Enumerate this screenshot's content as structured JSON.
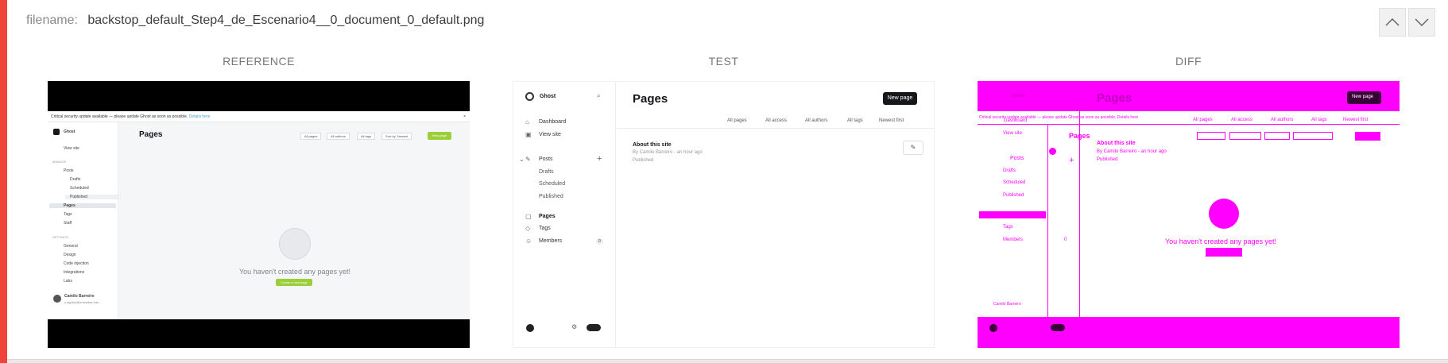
{
  "header": {
    "filename_label": "filename:",
    "filename_value": "backstop_default_Step4_de_Escenario4__0_document_0_default.png",
    "prev_icon": "chevron-up-icon",
    "next_icon": "chevron-down-icon"
  },
  "columns": {
    "reference": "REFERENCE",
    "test": "TEST",
    "diff": "DIFF"
  },
  "reference": {
    "notice": "Critical security update available — please update Ghost as soon as possible.",
    "notice_link": "Details here",
    "brand": "Ghost",
    "view_site": "View site",
    "manage_label": "MANAGE",
    "posts": "Posts",
    "drafts": "Drafts",
    "scheduled": "Scheduled",
    "published": "Published",
    "pages": "Pages",
    "tags": "Tags",
    "staff": "Staff",
    "settings_label": "SETTINGS",
    "general": "General",
    "design": "Design",
    "code_injection": "Code injection",
    "integrations": "Integrations",
    "labs": "Labs",
    "user_name": "Camilo Barreiro",
    "user_email": "c.aguilar@uniandes.edu...",
    "page_title": "Pages",
    "filter_pages": "All pages",
    "filter_authors": "All authors",
    "filter_tags": "All tags",
    "filter_sort": "Sort by: Newest",
    "new_page": "New page",
    "empty_text": "You haven't created any pages yet!",
    "create_button": "Create a new page"
  },
  "test": {
    "brand": "Ghost",
    "dashboard": "Dashboard",
    "view_site": "View site",
    "posts": "Posts",
    "drafts": "Drafts",
    "scheduled": "Scheduled",
    "published": "Published",
    "pages": "Pages",
    "tags": "Tags",
    "members": "Members",
    "members_count": "0",
    "page_title": "Pages",
    "new_page": "New page",
    "filter_pages": "All pages",
    "filter_access": "All access",
    "filter_authors": "All authors",
    "filter_tags": "All tags",
    "filter_sort": "Newest first",
    "row_title": "About this site",
    "row_meta": "By Camilo Barreiro - an hour ago",
    "row_status": "Published"
  },
  "diff": {
    "notice": "Critical security update available — please update Ghost as soon as possible. Details here",
    "brand": "Ghost",
    "dashboard": "Dashboard",
    "view_site": "View site",
    "posts": "Posts",
    "drafts": "Drafts",
    "scheduled": "Scheduled",
    "published": "Published",
    "tags": "Tags",
    "members": "Members",
    "members_count": "0",
    "page_title": "Pages",
    "new_page": "New page",
    "filter_pages": "All pages",
    "filter_access": "All access",
    "filter_authors": "All authors",
    "filter_tags": "All tags",
    "filter_sort": "Newest first",
    "row_title": "About this site",
    "row_meta": "By Camilo Barreiro - an hour ago",
    "row_status": "Published",
    "empty_text": "You haven't created any pages yet!",
    "small_pages": "Pages",
    "small_user": "Camilo Barreiro"
  },
  "colors": {
    "status_bar": "#f0433a",
    "diff_highlight": "#ff00ff",
    "ghost_green": "#9acf3a"
  }
}
